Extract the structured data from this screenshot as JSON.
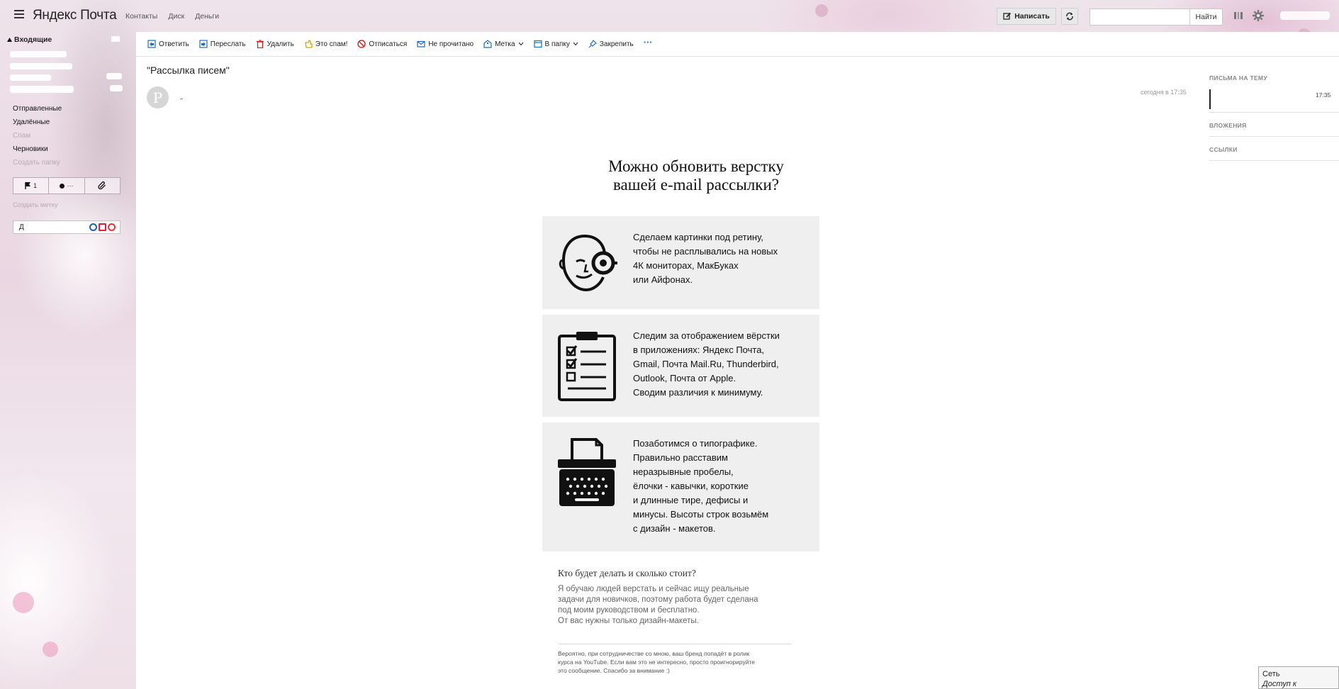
{
  "app": {
    "logo": "Яндекс Почта"
  },
  "topnav": [
    "Контакты",
    "Диск",
    "Деньги"
  ],
  "header": {
    "compose_label": "Написать",
    "search_placeholder": "",
    "search_button": "Найти"
  },
  "sidebar": {
    "inbox_label": "Входящие",
    "folders": [
      {
        "label": "Отправленные",
        "muted": false
      },
      {
        "label": "Удалённые",
        "muted": false
      },
      {
        "label": "Спам",
        "muted": true
      },
      {
        "label": "Черновики",
        "muted": false
      },
      {
        "label": "Создать папку",
        "muted": true
      }
    ],
    "filters": {
      "flagged_count": "1",
      "unread_label": "···"
    },
    "create_label": "Создать метку",
    "collector_text": "Д"
  },
  "toolbar": {
    "items": [
      {
        "label": "Ответить",
        "icon": "reply-icon"
      },
      {
        "label": "Переслать",
        "icon": "forward-icon"
      },
      {
        "label": "Удалить",
        "icon": "trash-icon"
      },
      {
        "label": "Это спам!",
        "icon": "spam-icon"
      },
      {
        "label": "Отписаться",
        "icon": "unsubscribe-icon"
      },
      {
        "label": "Не прочитано",
        "icon": "envelope-icon"
      },
      {
        "label": "Метка",
        "icon": "label-icon"
      },
      {
        "label": "В папку",
        "icon": "folder-icon"
      },
      {
        "label": "Закрепить",
        "icon": "pin-icon"
      }
    ],
    "more": "···"
  },
  "message": {
    "subject": "\"Рассылка писем\"",
    "avatar_letter": "Р",
    "date": "сегодня в 17:35"
  },
  "email": {
    "title_line1": "Можно обновить верстку",
    "title_line2": "вашей e-mail рассылки?",
    "cards": [
      {
        "icon": "face-loupe-icon",
        "text": "Сделаем картинки под ретину,\nчтобы не расплывались на новых\n4К мониторах, МакБуках\nили Айфонах."
      },
      {
        "icon": "checklist-icon",
        "text": "Следим за отображением вёрстки\nв приложениях: Яндекс Почта,\nGmail, Почта Mail.Ru, Thunderbird,\nOutlook, Почта от Apple.\nСводим различия к минимуму."
      },
      {
        "icon": "typewriter-icon",
        "text": "Позаботимся о типографике.\nПравильно расставим\nнеразрывные пробелы,\nёлочки - кавычки, короткие\nи длинные тире, дефисы и\nминусы. Высоты строк возьмём\nс дизайн - макетов."
      }
    ],
    "question_title": "Кто будет делать и сколько стоит?",
    "question_text": "Я обучаю людей верстать и сейчас ищу реальные\nзадачи для новичков, поэтому работа будет сделана\nпод моим руководством и бесплатно.\nОт вас нужны только дизайн-макеты.",
    "fine_print": "Вероятно, при сотрудничестве со мною, ваш бренд попадёт в ролик\nкурса на YouTube. Если вам это не интересно, просто проигнорируйте\nэто сообщение. Спасибо за внимание :)"
  },
  "right_panel": {
    "thread_label": "ПИСЬМА НА ТЕМУ",
    "thread_time": "17:35",
    "attachments_label": "ВЛОЖЕНИЯ",
    "links_label": "ССЫЛКИ"
  },
  "network_popup": {
    "line1": "Сеть",
    "line2": "Доступ к Интернету"
  }
}
